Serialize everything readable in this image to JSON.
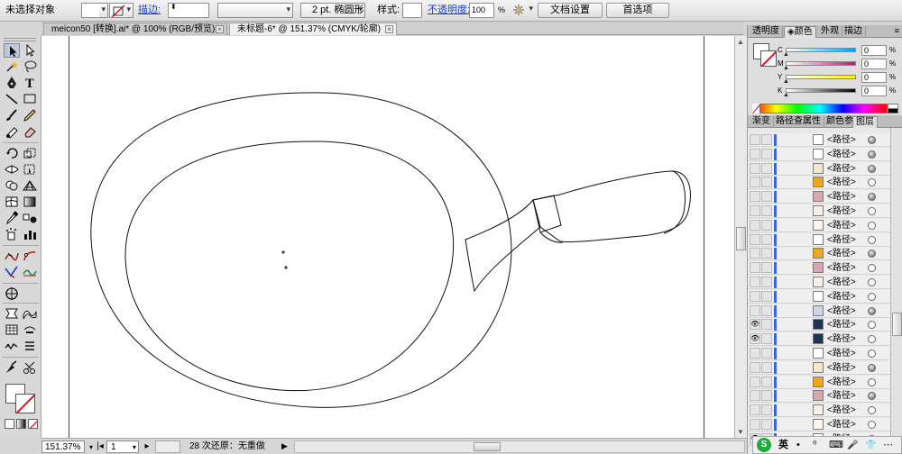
{
  "control_bar": {
    "selection_label": "未选择对象",
    "stroke_label": "描边:",
    "stroke_profile": "2 pt. 椭圆形",
    "style_label": "样式:",
    "opacity_label": "不透明度:",
    "opacity_value": "100",
    "opacity_unit": "%",
    "doc_setup_label": "文档设置",
    "preferences_label": "首选项"
  },
  "tabs": [
    {
      "label": "meicon50 [转换].ai* @ 100% (RGB/预览)",
      "active": false
    },
    {
      "label": "未标题-6* @ 151.37% (CMYK/轮廓)",
      "active": true
    }
  ],
  "tab_close_glyph": "×",
  "status": {
    "zoom": "151.37%",
    "page": "1",
    "message": "28 次还原：无重做",
    "nav_first": "|◂",
    "nav_next": "▸",
    "arrow": "▶"
  },
  "color_panel": {
    "tabs": [
      "透明度",
      "颜色",
      "外观",
      "描边"
    ],
    "active_tab": "颜色",
    "channels": [
      {
        "label": "C",
        "value": "0",
        "unit": "%",
        "gradient_end": "#00a0e9"
      },
      {
        "label": "M",
        "value": "0",
        "unit": "%",
        "gradient_end": "#e4007f"
      },
      {
        "label": "Y",
        "value": "0",
        "unit": "%",
        "gradient_end": "#fff100"
      },
      {
        "label": "K",
        "value": "0",
        "unit": "%",
        "gradient_end": "#000000"
      }
    ]
  },
  "layers_panel": {
    "tabs": [
      "渐变",
      "路径查",
      "属性",
      "颜色参",
      "图层"
    ],
    "active_tab": "图层",
    "item_label": "<路径>",
    "rows": [
      {
        "thumb": "#ffffff",
        "visible": false,
        "target": "on"
      },
      {
        "thumb": "#ffffff",
        "visible": false,
        "target": "on"
      },
      {
        "thumb": "#f6e6c8",
        "visible": false,
        "target": "on"
      },
      {
        "thumb": "#f1a51a",
        "visible": false,
        "target": "off"
      },
      {
        "thumb": "#d6a7ae",
        "visible": false,
        "target": "on"
      },
      {
        "thumb": "#f8f0e6",
        "visible": false,
        "target": "off"
      },
      {
        "thumb": "#fdf6ea",
        "visible": false,
        "target": "off"
      },
      {
        "thumb": "#ffffff",
        "visible": false,
        "target": "off"
      },
      {
        "thumb": "#f1a51a",
        "visible": false,
        "target": "on"
      },
      {
        "thumb": "#d6a7ae",
        "visible": false,
        "target": "off"
      },
      {
        "thumb": "#f8f0e6",
        "visible": false,
        "target": "off"
      },
      {
        "thumb": "#ffffff",
        "visible": false,
        "target": "off"
      },
      {
        "thumb": "#ccd6e4",
        "visible": false,
        "target": "on"
      },
      {
        "thumb": "#1d3552",
        "visible": true,
        "target": "off"
      },
      {
        "thumb": "#1d3552",
        "visible": true,
        "target": "off"
      },
      {
        "thumb": "#ffffff",
        "visible": false,
        "target": "off"
      },
      {
        "thumb": "#f6e6c8",
        "visible": false,
        "target": "on"
      },
      {
        "thumb": "#f1a51a",
        "visible": false,
        "target": "off"
      },
      {
        "thumb": "#d6a7ae",
        "visible": false,
        "target": "on"
      },
      {
        "thumb": "#f8f0e6",
        "visible": false,
        "target": "off"
      },
      {
        "thumb": "#fdf6ea",
        "visible": false,
        "target": "off"
      },
      {
        "thumb": "#ffffff",
        "visible": true,
        "target": "on"
      }
    ]
  },
  "ime": {
    "logo": "S",
    "lang": "英",
    "icons": [
      "•",
      "⁰",
      "⌨",
      "🎤",
      "👕",
      "⋯"
    ]
  },
  "colors": {
    "accent_blue": "#3d64d6",
    "link_blue": "#1a44c8",
    "none_red": "#e0121f"
  }
}
